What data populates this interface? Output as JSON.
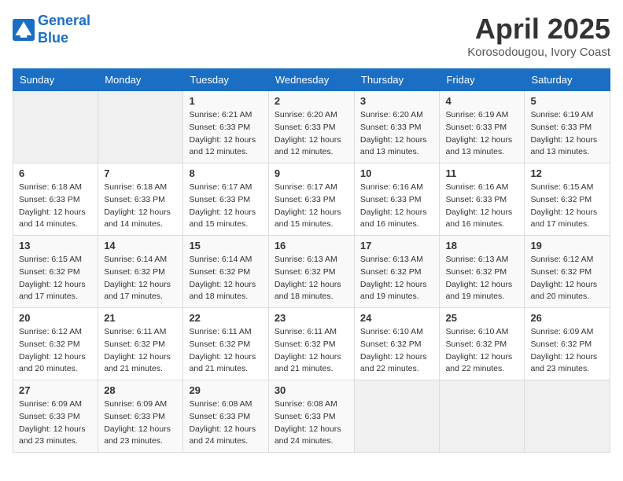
{
  "header": {
    "logo_line1": "General",
    "logo_line2": "Blue",
    "month_year": "April 2025",
    "location": "Korosodougou, Ivory Coast"
  },
  "weekdays": [
    "Sunday",
    "Monday",
    "Tuesday",
    "Wednesday",
    "Thursday",
    "Friday",
    "Saturday"
  ],
  "weeks": [
    [
      {
        "day": "",
        "info": ""
      },
      {
        "day": "",
        "info": ""
      },
      {
        "day": "1",
        "info": "Sunrise: 6:21 AM\nSunset: 6:33 PM\nDaylight: 12 hours\nand 12 minutes."
      },
      {
        "day": "2",
        "info": "Sunrise: 6:20 AM\nSunset: 6:33 PM\nDaylight: 12 hours\nand 12 minutes."
      },
      {
        "day": "3",
        "info": "Sunrise: 6:20 AM\nSunset: 6:33 PM\nDaylight: 12 hours\nand 13 minutes."
      },
      {
        "day": "4",
        "info": "Sunrise: 6:19 AM\nSunset: 6:33 PM\nDaylight: 12 hours\nand 13 minutes."
      },
      {
        "day": "5",
        "info": "Sunrise: 6:19 AM\nSunset: 6:33 PM\nDaylight: 12 hours\nand 13 minutes."
      }
    ],
    [
      {
        "day": "6",
        "info": "Sunrise: 6:18 AM\nSunset: 6:33 PM\nDaylight: 12 hours\nand 14 minutes."
      },
      {
        "day": "7",
        "info": "Sunrise: 6:18 AM\nSunset: 6:33 PM\nDaylight: 12 hours\nand 14 minutes."
      },
      {
        "day": "8",
        "info": "Sunrise: 6:17 AM\nSunset: 6:33 PM\nDaylight: 12 hours\nand 15 minutes."
      },
      {
        "day": "9",
        "info": "Sunrise: 6:17 AM\nSunset: 6:33 PM\nDaylight: 12 hours\nand 15 minutes."
      },
      {
        "day": "10",
        "info": "Sunrise: 6:16 AM\nSunset: 6:33 PM\nDaylight: 12 hours\nand 16 minutes."
      },
      {
        "day": "11",
        "info": "Sunrise: 6:16 AM\nSunset: 6:33 PM\nDaylight: 12 hours\nand 16 minutes."
      },
      {
        "day": "12",
        "info": "Sunrise: 6:15 AM\nSunset: 6:32 PM\nDaylight: 12 hours\nand 17 minutes."
      }
    ],
    [
      {
        "day": "13",
        "info": "Sunrise: 6:15 AM\nSunset: 6:32 PM\nDaylight: 12 hours\nand 17 minutes."
      },
      {
        "day": "14",
        "info": "Sunrise: 6:14 AM\nSunset: 6:32 PM\nDaylight: 12 hours\nand 17 minutes."
      },
      {
        "day": "15",
        "info": "Sunrise: 6:14 AM\nSunset: 6:32 PM\nDaylight: 12 hours\nand 18 minutes."
      },
      {
        "day": "16",
        "info": "Sunrise: 6:13 AM\nSunset: 6:32 PM\nDaylight: 12 hours\nand 18 minutes."
      },
      {
        "day": "17",
        "info": "Sunrise: 6:13 AM\nSunset: 6:32 PM\nDaylight: 12 hours\nand 19 minutes."
      },
      {
        "day": "18",
        "info": "Sunrise: 6:13 AM\nSunset: 6:32 PM\nDaylight: 12 hours\nand 19 minutes."
      },
      {
        "day": "19",
        "info": "Sunrise: 6:12 AM\nSunset: 6:32 PM\nDaylight: 12 hours\nand 20 minutes."
      }
    ],
    [
      {
        "day": "20",
        "info": "Sunrise: 6:12 AM\nSunset: 6:32 PM\nDaylight: 12 hours\nand 20 minutes."
      },
      {
        "day": "21",
        "info": "Sunrise: 6:11 AM\nSunset: 6:32 PM\nDaylight: 12 hours\nand 21 minutes."
      },
      {
        "day": "22",
        "info": "Sunrise: 6:11 AM\nSunset: 6:32 PM\nDaylight: 12 hours\nand 21 minutes."
      },
      {
        "day": "23",
        "info": "Sunrise: 6:11 AM\nSunset: 6:32 PM\nDaylight: 12 hours\nand 21 minutes."
      },
      {
        "day": "24",
        "info": "Sunrise: 6:10 AM\nSunset: 6:32 PM\nDaylight: 12 hours\nand 22 minutes."
      },
      {
        "day": "25",
        "info": "Sunrise: 6:10 AM\nSunset: 6:32 PM\nDaylight: 12 hours\nand 22 minutes."
      },
      {
        "day": "26",
        "info": "Sunrise: 6:09 AM\nSunset: 6:32 PM\nDaylight: 12 hours\nand 23 minutes."
      }
    ],
    [
      {
        "day": "27",
        "info": "Sunrise: 6:09 AM\nSunset: 6:33 PM\nDaylight: 12 hours\nand 23 minutes."
      },
      {
        "day": "28",
        "info": "Sunrise: 6:09 AM\nSunset: 6:33 PM\nDaylight: 12 hours\nand 23 minutes."
      },
      {
        "day": "29",
        "info": "Sunrise: 6:08 AM\nSunset: 6:33 PM\nDaylight: 12 hours\nand 24 minutes."
      },
      {
        "day": "30",
        "info": "Sunrise: 6:08 AM\nSunset: 6:33 PM\nDaylight: 12 hours\nand 24 minutes."
      },
      {
        "day": "",
        "info": ""
      },
      {
        "day": "",
        "info": ""
      },
      {
        "day": "",
        "info": ""
      }
    ]
  ]
}
